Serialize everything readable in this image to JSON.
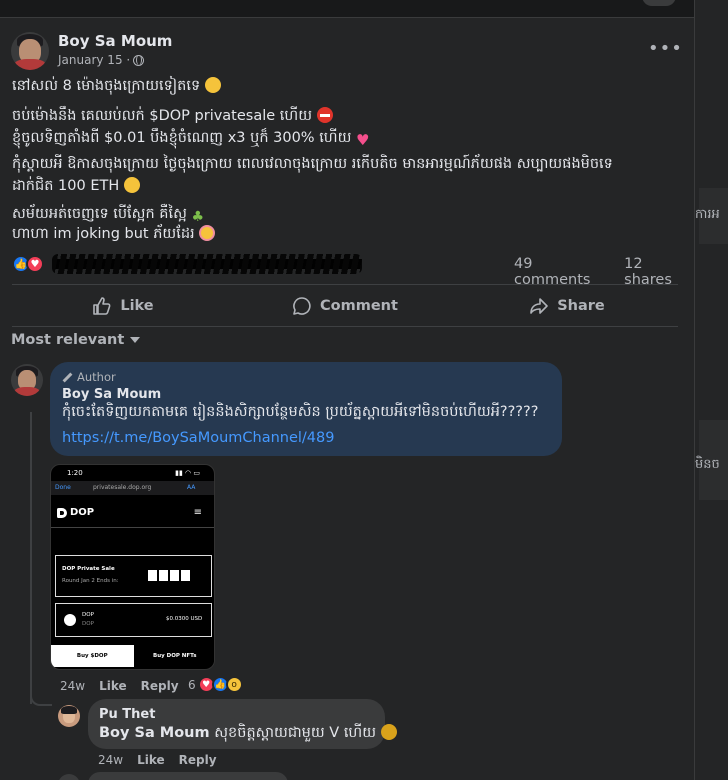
{
  "post": {
    "author": "Boy Sa Moum",
    "date": "January 15 ·",
    "more": "•••",
    "lines": [
      "នៅសល់ 8 ម៉ោងចុងក្រោយទៀតទេ",
      "ចប់ម៉ោងនឹង គេឈប់លក់ $DOP privatesale ហើយ",
      "ខ្ញុំចូលទិញតាំងពី $0.01 បឹងខ្ញុំចំណេញ x3 ឬក៏ 300% ហើយ",
      "កុំស្ដាយអី ឱកាសចុងក្រោយ ថ្ងៃចុងក្រោយ ពេលវេលាចុងក្រោយ រកើបតិច មានអារម្មណ៍ភ័យផង សប្បាយផងមិចទេ",
      "ដាក់ជិត 100 ETH",
      "សម័យអត់ចេញទេ បើស្អែក គឺស្អៃ",
      "ហាហា im joking but ភ័យដែរ"
    ],
    "comments_count": "49 comments",
    "shares_count": "12 shares"
  },
  "actions": {
    "like": "Like",
    "comment": "Comment",
    "share": "Share"
  },
  "sort_label": "Most relevant",
  "comment": {
    "badge": "Author",
    "name": "Boy Sa Moum",
    "text": "កុំចេះតែទិញយកតាមគេ រៀននិងសិក្សាបន្ថែមសិន ប្រយ័ត្នស្ដាយអីទៅមិនចប់ហើយអី?????",
    "link": "https://t.me/BoySaMoumChannel/489",
    "time": "24w",
    "like": "Like",
    "reply": "Reply",
    "reactions": "6"
  },
  "screenshot": {
    "time": "1:20",
    "url": "privatesale.dop.org",
    "done": "Done",
    "aa": "AA",
    "logo": "DOP",
    "sale_title": "DOP Private Sale",
    "sale_sub": "Round Jan 2 Ends in:",
    "token": "DOP",
    "token_sub": "DOP",
    "price": "$0.0300 USD",
    "buy": "Buy $DOP",
    "nfts": "Buy DOP NFTs"
  },
  "reply": {
    "name": "Pu Thet",
    "mention": "Boy Sa Moum",
    "text": "សុខចិត្តស្ដាយជាមួយ V ហើយ",
    "time": "24w",
    "like": "Like",
    "reply": "Reply"
  },
  "right_fragments": [
    "ការអ",
    "មិនច"
  ],
  "colors": {
    "bg": "#18191a",
    "card": "#242526",
    "author_bubble": "#263951",
    "link": "#4599ff",
    "like_blue": "#1877f2",
    "love_red": "#f33e58"
  }
}
